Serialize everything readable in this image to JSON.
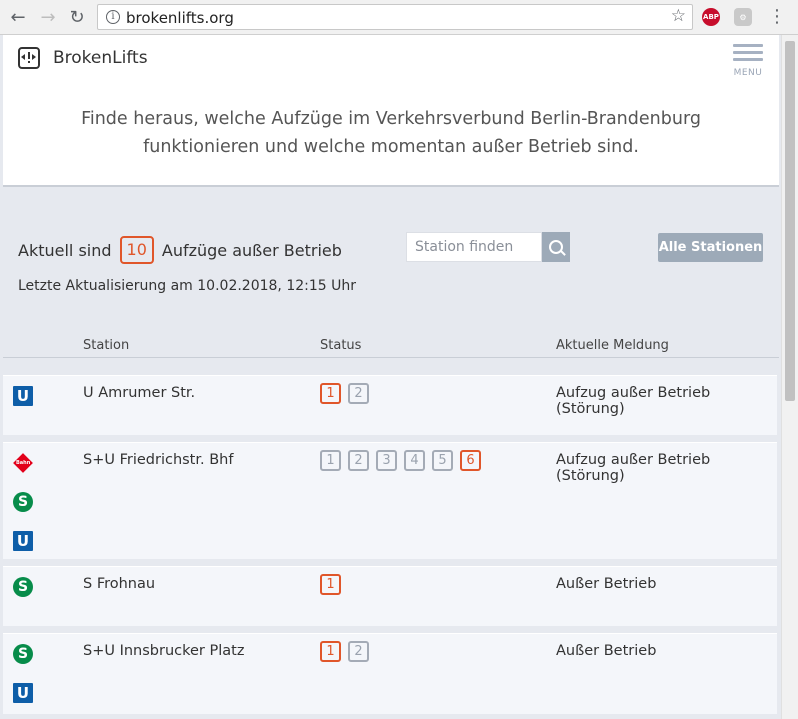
{
  "browser": {
    "url": "brokenlifts.org",
    "ext_abp": "ABP"
  },
  "header": {
    "brand": "BrokenLifts",
    "menu_label": "MENU",
    "tagline": "Finde heraus, welche Aufzüge im Verkehrsverbund Berlin-Brandenburg funktionieren und welche momentan außer Betrieb sind."
  },
  "summary": {
    "prefix": "Aktuell sind",
    "count": "10",
    "suffix": "Aufzüge außer Betrieb",
    "updated": "Letzte Aktualisierung am 10.02.2018, 12:15 Uhr"
  },
  "search": {
    "placeholder": "Station finden",
    "all_button": "Alle Stationen"
  },
  "table": {
    "col_station": "Station",
    "col_status": "Status",
    "col_message": "Aktuelle Meldung"
  },
  "stations": [
    {
      "name": "U Amrumer Str.",
      "lines": [
        "U"
      ],
      "lifts": [
        "1",
        "2"
      ],
      "broken": [
        "1"
      ],
      "message": "Aufzug außer Betrieb (Störung)"
    },
    {
      "name": "S+U Friedrichstr. Bhf",
      "lines": [
        "DB",
        "S",
        "U"
      ],
      "lifts": [
        "1",
        "2",
        "3",
        "4",
        "5",
        "6"
      ],
      "broken": [
        "6"
      ],
      "message": "Aufzug außer Betrieb (Störung)"
    },
    {
      "name": "S Frohnau",
      "lines": [
        "S"
      ],
      "lifts": [
        "1"
      ],
      "broken": [
        "1"
      ],
      "message": "Außer Betrieb"
    },
    {
      "name": "S+U Innsbrucker Platz",
      "lines": [
        "S",
        "U"
      ],
      "lifts": [
        "1",
        "2"
      ],
      "broken": [
        "1"
      ],
      "message": "Außer Betrieb"
    }
  ],
  "icons": {
    "U": "U",
    "S": "S",
    "DB": "Bahn"
  },
  "colors": {
    "broken": "#e0562a",
    "ok": "#a4abb6",
    "ubahn": "#0e5ea8",
    "sbahn": "#078c4a",
    "db": "#e2001a",
    "button": "#9daab8"
  }
}
